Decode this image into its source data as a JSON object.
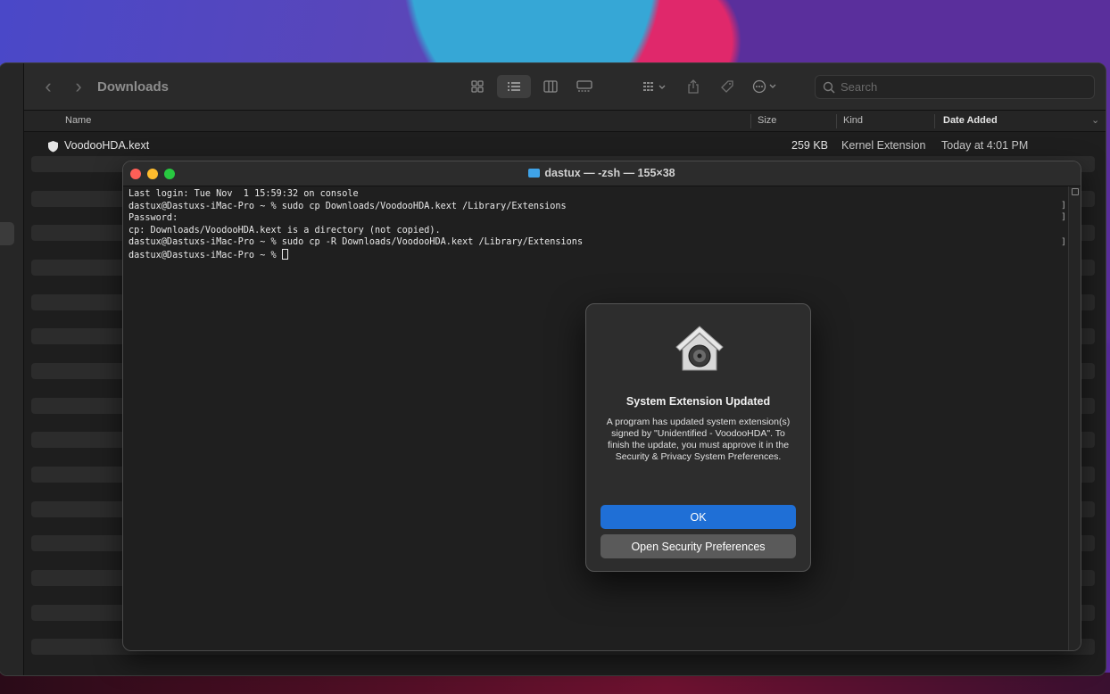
{
  "finder": {
    "title": "Downloads",
    "nav_back": "‹",
    "nav_forward": "›",
    "search_placeholder": "Search",
    "columns": {
      "name": "Name",
      "size": "Size",
      "kind": "Kind",
      "date_added": "Date Added"
    },
    "files": [
      {
        "name": "VoodooHDA.kext",
        "size": "259 KB",
        "kind": "Kernel Extension",
        "date_added": "Today at 4:01 PM"
      }
    ]
  },
  "terminal": {
    "title": "dastux — -zsh — 155×38",
    "lines": [
      "Last login: Tue Nov  1 15:59:32 on console",
      "dastux@Dastuxs-iMac-Pro ~ % sudo cp Downloads/VoodooHDA.kext /Library/Extensions",
      "Password:",
      "cp: Downloads/VoodooHDA.kext is a directory (not copied).",
      "dastux@Dastuxs-iMac-Pro ~ % sudo cp -R Downloads/VoodooHDA.kext /Library/Extensions",
      "dastux@Dastuxs-iMac-Pro ~ % "
    ]
  },
  "dialog": {
    "title": "System Extension Updated",
    "message": "A program has updated system extension(s) signed by \"Unidentified - VoodooHDA\". To finish the update, you must approve it in the Security & Privacy System Preferences.",
    "ok_label": "OK",
    "open_security_label": "Open Security Preferences"
  },
  "colors": {
    "accent": "#1f6fd6",
    "close": "#ff5f57",
    "minimize": "#febc2e",
    "zoom": "#28c840"
  }
}
